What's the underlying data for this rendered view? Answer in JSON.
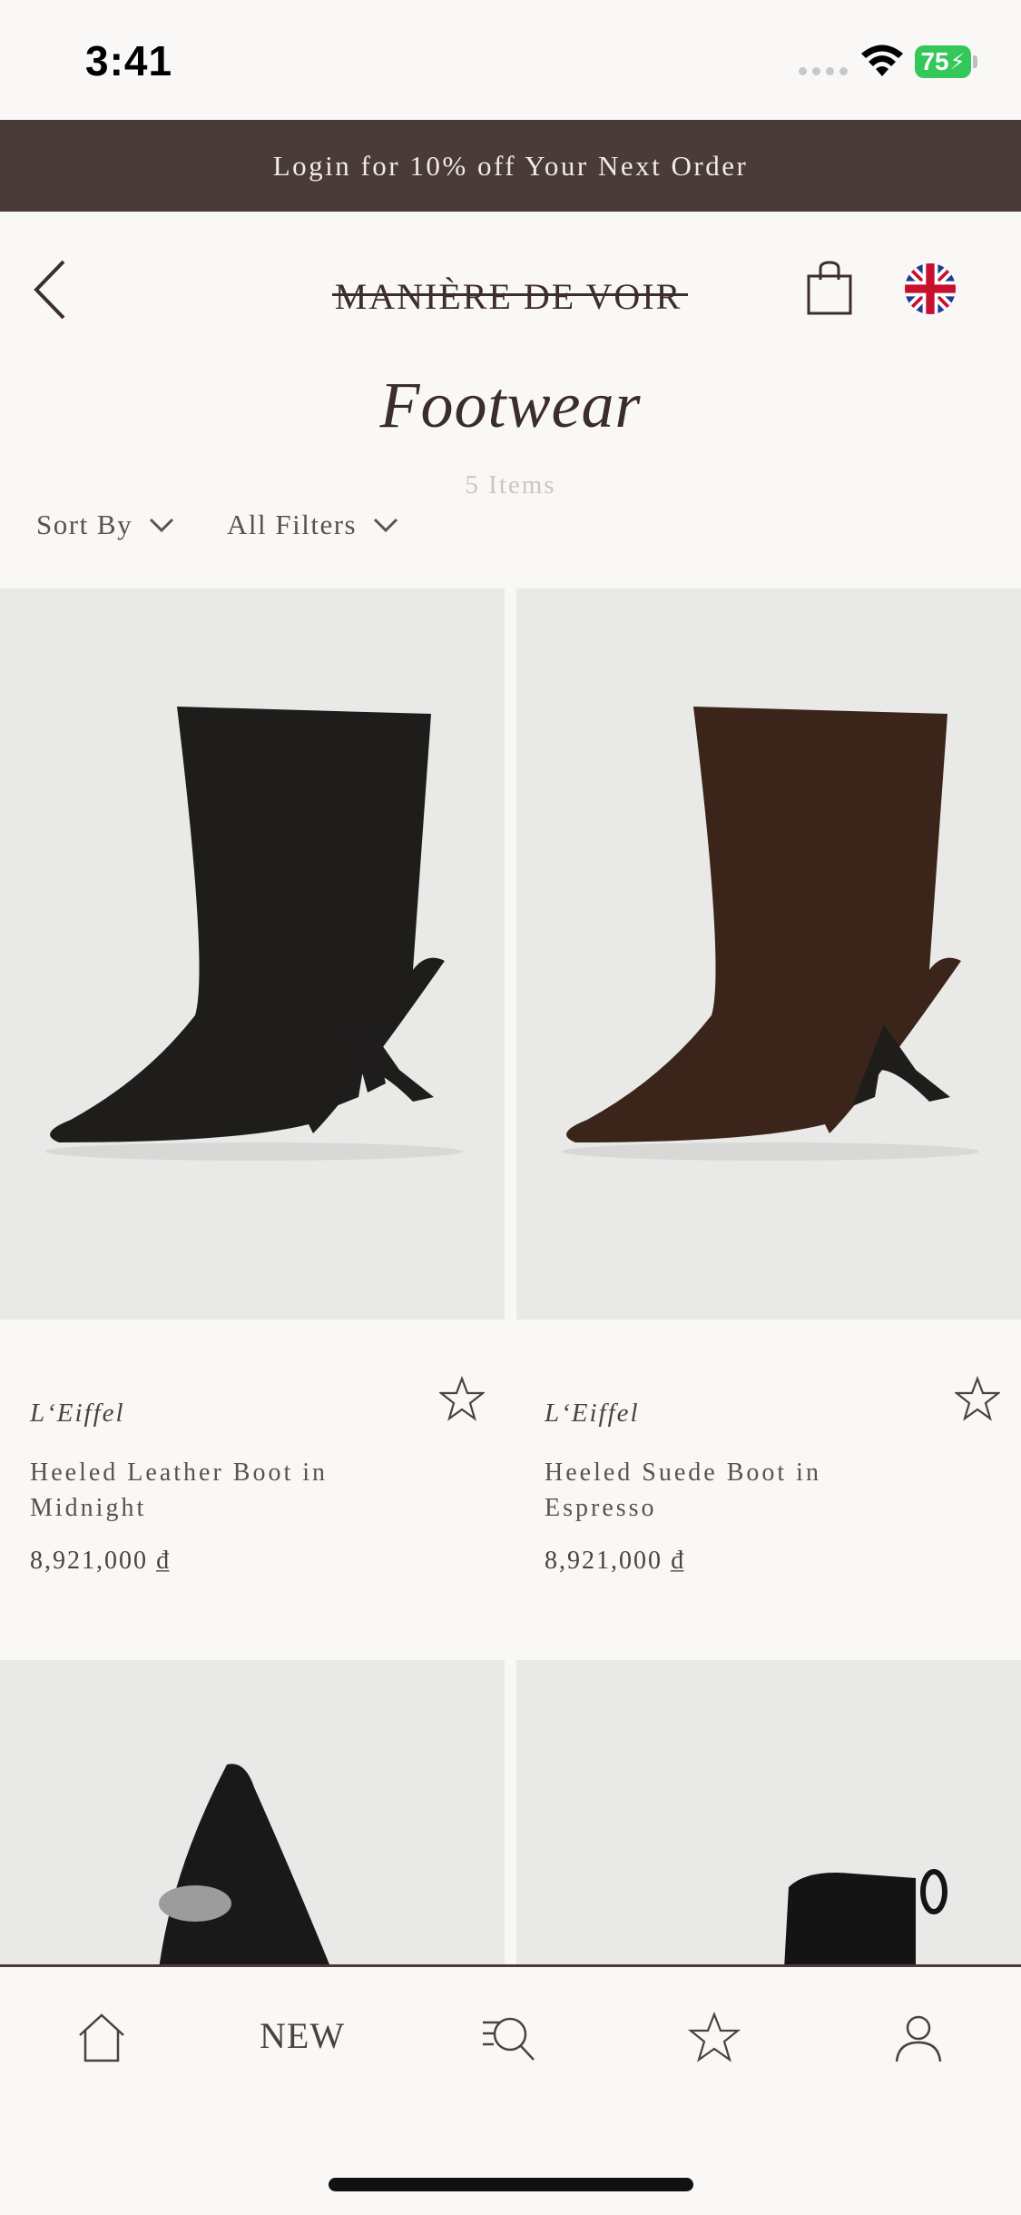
{
  "status_bar": {
    "time": "3:41",
    "battery": "75"
  },
  "promo": {
    "text": "Login for 10% off Your Next Order"
  },
  "header": {
    "logo": "MANIÈRE DE VOIR"
  },
  "page": {
    "title": "Footwear",
    "count": "5 Items"
  },
  "filters": {
    "sort_label": "Sort By",
    "filters_label": "All Filters"
  },
  "products": [
    {
      "brand": "L‘Eiffel",
      "name": "Heeled Leather Boot in Midnight",
      "price": "8,921,000 ₫",
      "color": "#1e1d1c"
    },
    {
      "brand": "L‘Eiffel",
      "name": "Heeled Suede Boot in Espresso",
      "price": "8,921,000 ₫",
      "color": "#3b241a"
    }
  ],
  "bottom_nav": {
    "new_label": "NEW"
  },
  "colors": {
    "banner": "#4a3b39",
    "background": "#f9f8f6",
    "image_bg": "#e9e9e8",
    "battery": "#34c759"
  }
}
